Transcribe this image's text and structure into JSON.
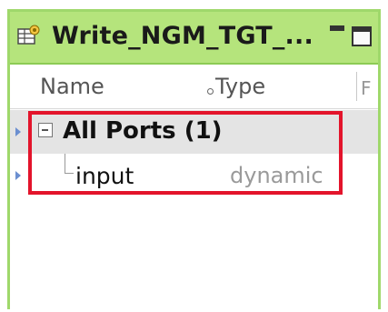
{
  "panel": {
    "title": "Write_NGM_TGT_...",
    "title_icon": "target-table-icon",
    "minimize_icon": "minimize-icon",
    "maximize_icon": "maximize-icon"
  },
  "columns": {
    "name": "Name",
    "type": "Type",
    "more": "F"
  },
  "rows": [
    {
      "name": "All Ports (1)",
      "type": "",
      "expanded": true
    },
    {
      "name": "input",
      "type": "dynamic"
    }
  ],
  "colors": {
    "title_bar": "#b5e47c",
    "frame": "#9fd86b",
    "highlight_box": "#e3142b",
    "selected_row": "#e4e4e4"
  }
}
